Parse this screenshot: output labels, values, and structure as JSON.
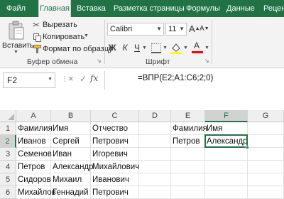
{
  "tabs": [
    {
      "label": "Файл",
      "active": false
    },
    {
      "label": "Главная",
      "active": true
    },
    {
      "label": "Вставка",
      "active": false
    },
    {
      "label": "Разметка страницы",
      "active": false
    },
    {
      "label": "Формулы",
      "active": false
    },
    {
      "label": "Данные",
      "active": false
    },
    {
      "label": "Реценз",
      "active": false
    }
  ],
  "ribbon": {
    "paste_label": "Вставить",
    "cut_label": "Вырезать",
    "copy_label": "Копировать",
    "format_painter_label": "Формат по образцу",
    "clipboard_group": "Буфер обмена",
    "font_name": "Calibri",
    "font_size": "11",
    "bold": "Ж",
    "italic": "К",
    "underline": "Ч",
    "grow_font": "A",
    "shrink_font": "A",
    "font_group": "Шрифт",
    "font_color": "#ff0000",
    "fill_color": "#ffff00"
  },
  "formula_bar": {
    "name_box": "F2",
    "cancel_symbol": "×",
    "enter_symbol": "✓",
    "fx_label": "fx",
    "formula": "=ВПР(E2;A1:C6;2;0)"
  },
  "grid": {
    "columns": [
      "A",
      "B",
      "C",
      "D",
      "E",
      "F",
      "G"
    ],
    "rows": [
      {
        "num": "1",
        "cells": [
          "Фамилия",
          "Имя",
          "Отчество",
          "",
          "Фамилия",
          "Имя",
          ""
        ]
      },
      {
        "num": "2",
        "cells": [
          "Иванов",
          "Сергей",
          "Петрович",
          "",
          "Петров",
          "Александр",
          ""
        ]
      },
      {
        "num": "3",
        "cells": [
          "Семенов",
          "Иван",
          "Игоревич",
          "",
          "",
          "",
          ""
        ]
      },
      {
        "num": "4",
        "cells": [
          "Петров",
          "Александр",
          "Михайлович",
          "",
          "",
          "",
          ""
        ]
      },
      {
        "num": "5",
        "cells": [
          "Сидоров",
          "Михаил",
          "Иванович",
          "",
          "",
          "",
          ""
        ]
      },
      {
        "num": "6",
        "cells": [
          "Михайлов",
          "Геннадий",
          "Петрович",
          "",
          "",
          "",
          ""
        ]
      }
    ],
    "selected_column": "F",
    "selected_row": "2",
    "accent": "#217346"
  }
}
